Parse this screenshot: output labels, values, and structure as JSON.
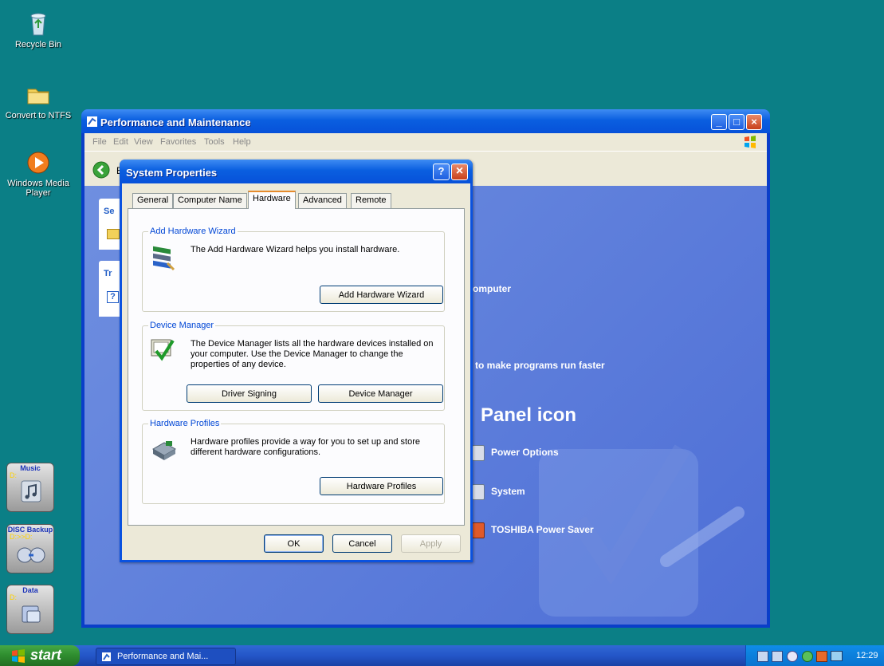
{
  "desktop": {
    "icons": [
      {
        "label": "Recycle Bin",
        "icon": "recycle-bin-icon"
      },
      {
        "label": "Convert to NTFS",
        "icon": "folder-icon"
      },
      {
        "label": "Windows Media Player",
        "icon": "media-player-icon"
      }
    ],
    "side_buttons": [
      {
        "label": "Music",
        "sub": "D:",
        "icon": "music-note-icon"
      },
      {
        "label": "DISC Backup",
        "sub": "D:>>D:",
        "icon": "disc-icon"
      },
      {
        "label": "Data",
        "sub": "D:",
        "icon": "data-drive-icon"
      }
    ]
  },
  "explorer": {
    "title": "Performance and Maintenance",
    "menu": [
      "File",
      "Edit",
      "View",
      "Favorites",
      "Tools",
      "Help"
    ],
    "back_label": "B",
    "side_panels": [
      "Se",
      "Tr"
    ],
    "content": {
      "computer_fragment": "omputer",
      "task_fragment": "to make programs run faster",
      "heading_fragment": "Panel icon",
      "items": [
        "Power Options",
        "System",
        "TOSHIBA Power Saver"
      ]
    }
  },
  "dialog": {
    "title": "System Properties",
    "help_button": "?",
    "close_button": "×",
    "tabs": [
      "General",
      "Computer Name",
      "Hardware",
      "Advanced",
      "Remote"
    ],
    "active_tab": "Hardware",
    "groups": {
      "wizard": {
        "label": "Add Hardware Wizard",
        "text": "The Add Hardware Wizard helps you install hardware.",
        "button": "Add Hardware Wizard"
      },
      "device_manager": {
        "label": "Device Manager",
        "text": "The Device Manager lists all the hardware devices installed on your computer. Use the Device Manager to change the properties of any device.",
        "button_signing": "Driver Signing",
        "button_manager": "Device Manager"
      },
      "profiles": {
        "label": "Hardware Profiles",
        "text": "Hardware profiles provide a way for you to set up and store different hardware configurations.",
        "button": "Hardware Profiles"
      }
    },
    "buttons": {
      "ok": "OK",
      "cancel": "Cancel",
      "apply": "Apply"
    }
  },
  "taskbar": {
    "start_label": "start",
    "task_item": "Performance and Mai...",
    "clock": "12:29"
  },
  "colors": {
    "desktop": "#0b7f86",
    "title_bar": "#0a5fe0",
    "dialog_face": "#ece9d8",
    "group_label": "#0046d5"
  }
}
